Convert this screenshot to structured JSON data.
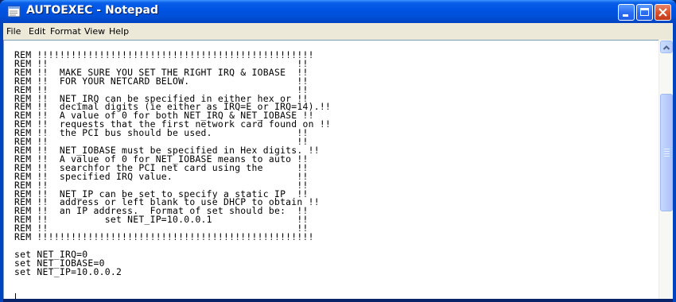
{
  "window": {
    "title": "AUTOEXEC - Notepad",
    "icon": "notepad-icon"
  },
  "title_buttons": {
    "minimize_icon": "minimize-icon",
    "maximize_icon": "maximize-icon",
    "close_icon": "close-icon"
  },
  "menu": {
    "items": [
      "File",
      "Edit",
      "Format",
      "View",
      "Help"
    ]
  },
  "document": {
    "text": "REM !!!!!!!!!!!!!!!!!!!!!!!!!!!!!!!!!!!!!!!!!!!!!!!!!\nREM !!                                            !!\nREM !!  MAKE SURE YOU SET THE RIGHT IRQ & IOBASE  !!\nREM !!  FOR YOUR NETCARD BELOW.                   !!\nREM !!                                            !!\nREM !!  NET_IRQ can be specified in either hex or !!\nREM !!  decimal digits (ie either as IRQ=E or IRQ=14).!!\nREM !!  A value of 0 for both NET_IRQ & NET_IOBASE !!\nREM !!  requests that the first network card found on !!\nREM !!  the PCI bus should be used.               !!\nREM !!                                            !!\nREM !!  NET_IOBASE must be specified in Hex digits. !!\nREM !!  A value of 0 for NET_IOBASE means to auto !!\nREM !!  searchfor the PCI net card using the      !!\nREM !!  specified IRQ value.                      !!\nREM !!                                            !!\nREM !!  NET_IP can be set to specify a static IP  !!\nREM !!  address or left blank to use DHCP to obtain !!\nREM !!  an IP address.  Format of set should be:  !!\nREM !!          set NET_IP=10.0.0.1               !!\nREM !!                                            !!\nREM !!!!!!!!!!!!!!!!!!!!!!!!!!!!!!!!!!!!!!!!!!!!!!!!!\n\nset NET_IRQ=0\nset NET_IOBASE=0\nset NET_IP=10.0.0.2\n"
  },
  "scrollbar": {
    "up_icon": "scroll-up-arrow-icon"
  },
  "colors": {
    "titlebar": "#0054e3",
    "menubar": "#ece9d8",
    "close_button": "#d9552f"
  }
}
